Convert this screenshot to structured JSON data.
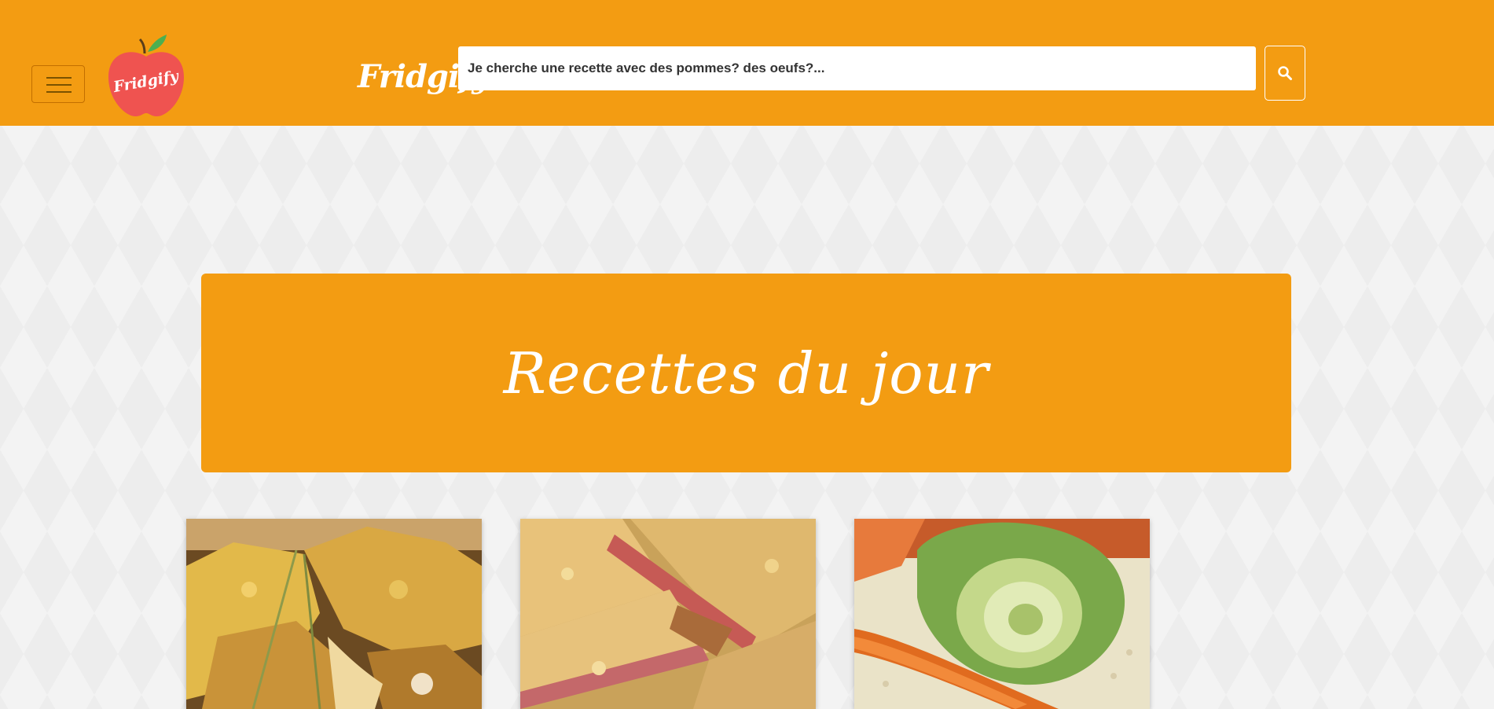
{
  "header": {
    "brand": "Fridgify",
    "logo_text": "Fridgify",
    "menu_icon": "hamburger-icon",
    "search": {
      "placeholder": "Je cherche une recette avec des pommes? des oeufs?...",
      "button_icon": "search-icon"
    }
  },
  "hero": {
    "title": "Recettes du jour"
  },
  "recipes": [
    {
      "image": "recipe-image-croque-gratine"
    },
    {
      "image": "recipe-image-ham-cheese-slices"
    },
    {
      "image": "recipe-image-couscous-vegetables"
    }
  ],
  "colors": {
    "primary": "#f39c12",
    "apple_red": "#ef5350",
    "leaf_green": "#4caf50",
    "text_white": "#ffffff"
  }
}
